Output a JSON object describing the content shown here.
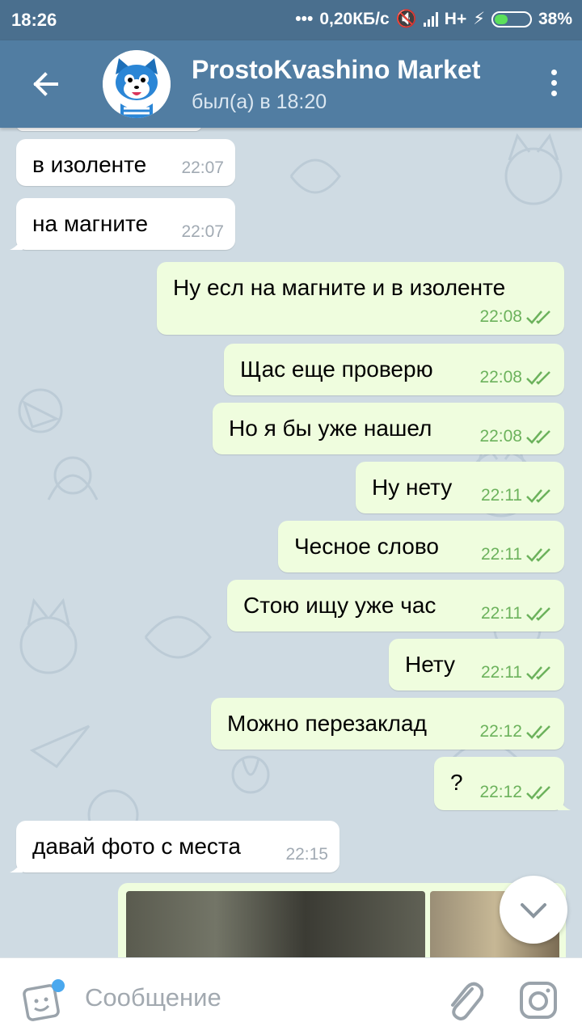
{
  "status": {
    "time": "18:26",
    "speed": "0,20КБ/с",
    "network": "H+",
    "battery": "38%"
  },
  "header": {
    "title": "ProstoKvashino Market",
    "subtitle": "был(а) в 18:20"
  },
  "messages": [
    {
      "dir": "in",
      "text": "в изоленте",
      "time": "22:07"
    },
    {
      "dir": "in",
      "text": "на магните",
      "time": "22:07"
    },
    {
      "dir": "out",
      "text": "Ну есл на магните и в изоленте",
      "time": "22:08"
    },
    {
      "dir": "out",
      "text": "Щас еще проверю",
      "time": "22:08"
    },
    {
      "dir": "out",
      "text": "Но я бы уже нашел",
      "time": "22:08"
    },
    {
      "dir": "out",
      "text": "Ну нету",
      "time": "22:11"
    },
    {
      "dir": "out",
      "text": "Чесное слово",
      "time": "22:11"
    },
    {
      "dir": "out",
      "text": "Стою ищу уже час",
      "time": "22:11"
    },
    {
      "dir": "out",
      "text": "Нету",
      "time": "22:11"
    },
    {
      "dir": "out",
      "text": "Можно перезаклад",
      "time": "22:12"
    },
    {
      "dir": "out",
      "text": "?",
      "time": "22:12"
    },
    {
      "dir": "in",
      "text": "давай фото с места",
      "time": "22:15"
    }
  ],
  "input": {
    "placeholder": "Сообщение"
  },
  "icons": {
    "back": "arrow-left-icon",
    "menu": "more-vertical-icon",
    "emoji": "sticker-icon",
    "attach": "paperclip-icon",
    "camera": "camera-icon",
    "scroll": "chevron-down-icon",
    "read": "double-check-icon"
  },
  "colors": {
    "header": "#517da2",
    "statusbar": "#4a6f8e",
    "outgoing": "#effdde",
    "incoming": "#ffffff",
    "check": "#6cb25c"
  }
}
